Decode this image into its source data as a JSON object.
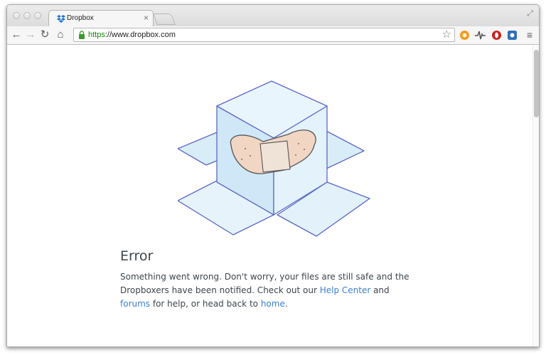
{
  "tab": {
    "title": "Dropbox",
    "close": "×"
  },
  "address_bar": {
    "scheme": "https",
    "rest": "://www.dropbox.com"
  },
  "extensions": [
    {
      "name": "orange-extension-icon",
      "color": "#f39a1c"
    },
    {
      "name": "waveform-extension-icon",
      "color": "#555555"
    },
    {
      "name": "opera-extension-icon",
      "color": "#cc1f1f"
    },
    {
      "name": "blue-extension-icon",
      "color": "#2f6fb5"
    }
  ],
  "page": {
    "heading": "Error",
    "line1": "Something went wrong. Don't worry, your files are still safe and the Dropboxers have been notified. Check out our ",
    "help_center_link": "Help Center",
    "line2": " and ",
    "forums_link": "forums",
    "line3": " for help, or head back to ",
    "home_link": "home",
    "line4": "."
  },
  "colors": {
    "link": "#3d80d2",
    "text": "#3d464d",
    "box_stroke": "#5b67c8",
    "box_fill": "#dbeef9",
    "bandage": "#f2d6c4"
  }
}
